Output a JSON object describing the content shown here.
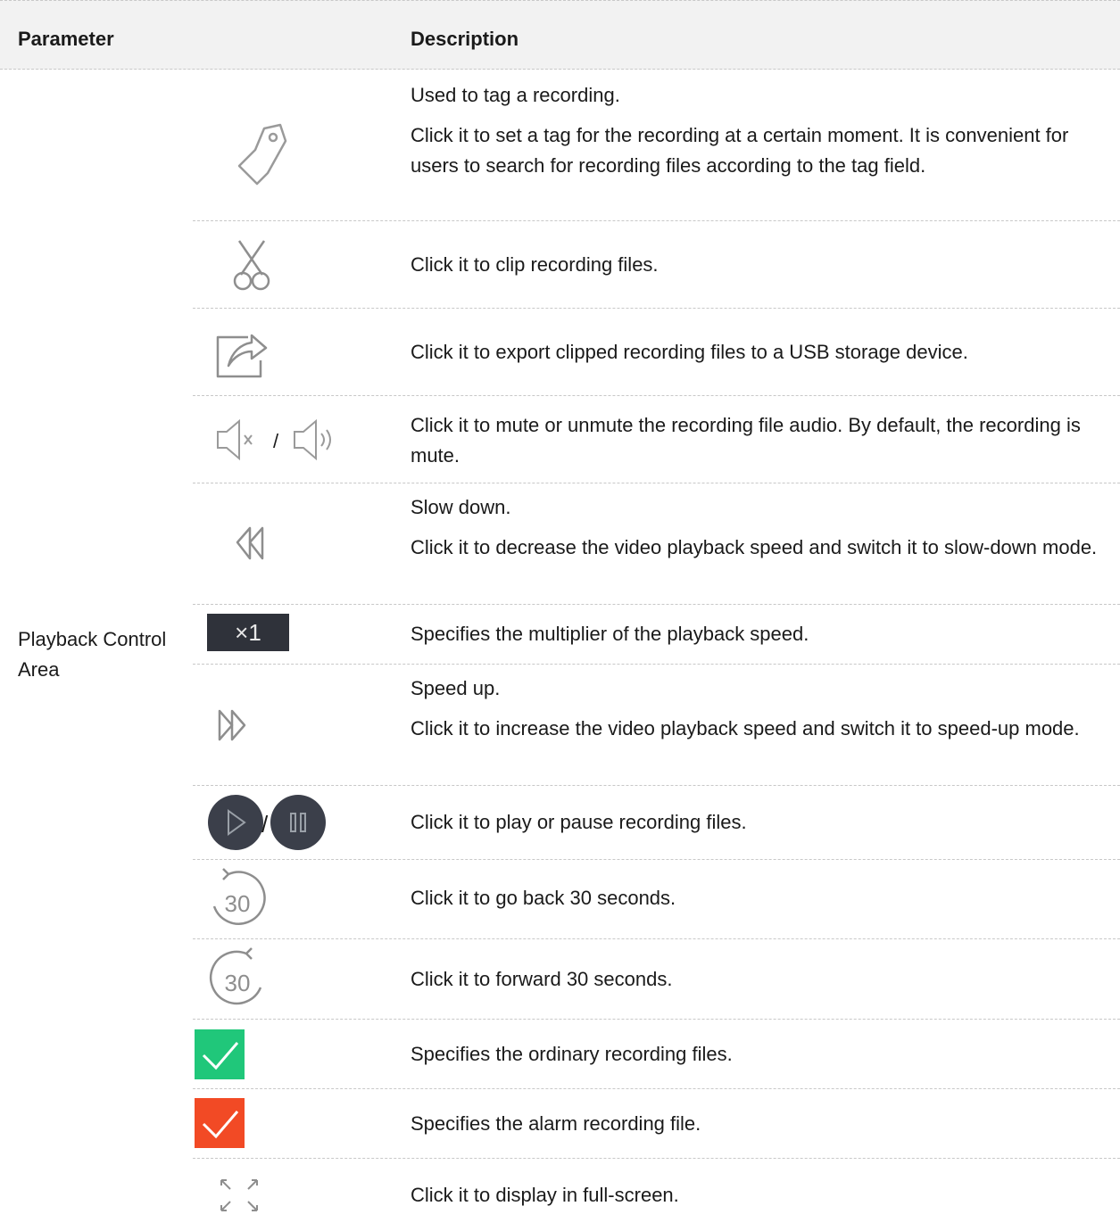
{
  "header": {
    "parameter": "Parameter",
    "description": "Description"
  },
  "group": {
    "parameter": "Playback Control Area"
  },
  "rows": [
    {
      "icon": "tag-icon",
      "lines": [
        "Used to tag a recording.",
        "Click it to set a tag for the recording at a certain moment. It is convenient for users to search for recording files according to the tag field."
      ]
    },
    {
      "icon": "scissors-icon",
      "lines": [
        "Click it to clip recording files."
      ]
    },
    {
      "icon": "export-icon",
      "lines": [
        "Click it to export clipped recording files to a USB storage device."
      ]
    },
    {
      "icon": "mute-unmute-icon",
      "separator": "/",
      "lines": [
        "Click it to mute or unmute the recording file audio. By default, the recording is mute."
      ]
    },
    {
      "icon": "rewind-icon",
      "lines": [
        "Slow down.",
        "Click it to decrease the video playback speed and switch it to slow-down mode."
      ]
    },
    {
      "icon": "speed-multiplier-icon",
      "badge": "×1",
      "lines": [
        "Specifies the multiplier of the playback speed."
      ]
    },
    {
      "icon": "fast-forward-icon",
      "lines": [
        "Speed up.",
        "Click it to increase the video playback speed and switch it to speed-up mode."
      ]
    },
    {
      "icon": "play-pause-icon",
      "separator": "/",
      "lines": [
        "Click it to play or pause recording files."
      ]
    },
    {
      "icon": "back-30-icon",
      "badge": "30",
      "lines": [
        "Click it to go back 30 seconds."
      ]
    },
    {
      "icon": "forward-30-icon",
      "badge": "30",
      "lines": [
        "Click it to forward 30 seconds."
      ]
    },
    {
      "icon": "green-check-icon",
      "lines": [
        "Specifies the ordinary recording files."
      ]
    },
    {
      "icon": "red-check-icon",
      "lines": [
        "Specifies the alarm recording file."
      ]
    },
    {
      "icon": "fullscreen-icon",
      "lines": [
        "Click it to display in full-screen."
      ]
    }
  ],
  "colors": {
    "ordinary": "#20c77a",
    "alarm": "#f24a25",
    "dark": "#3b3f4a"
  }
}
